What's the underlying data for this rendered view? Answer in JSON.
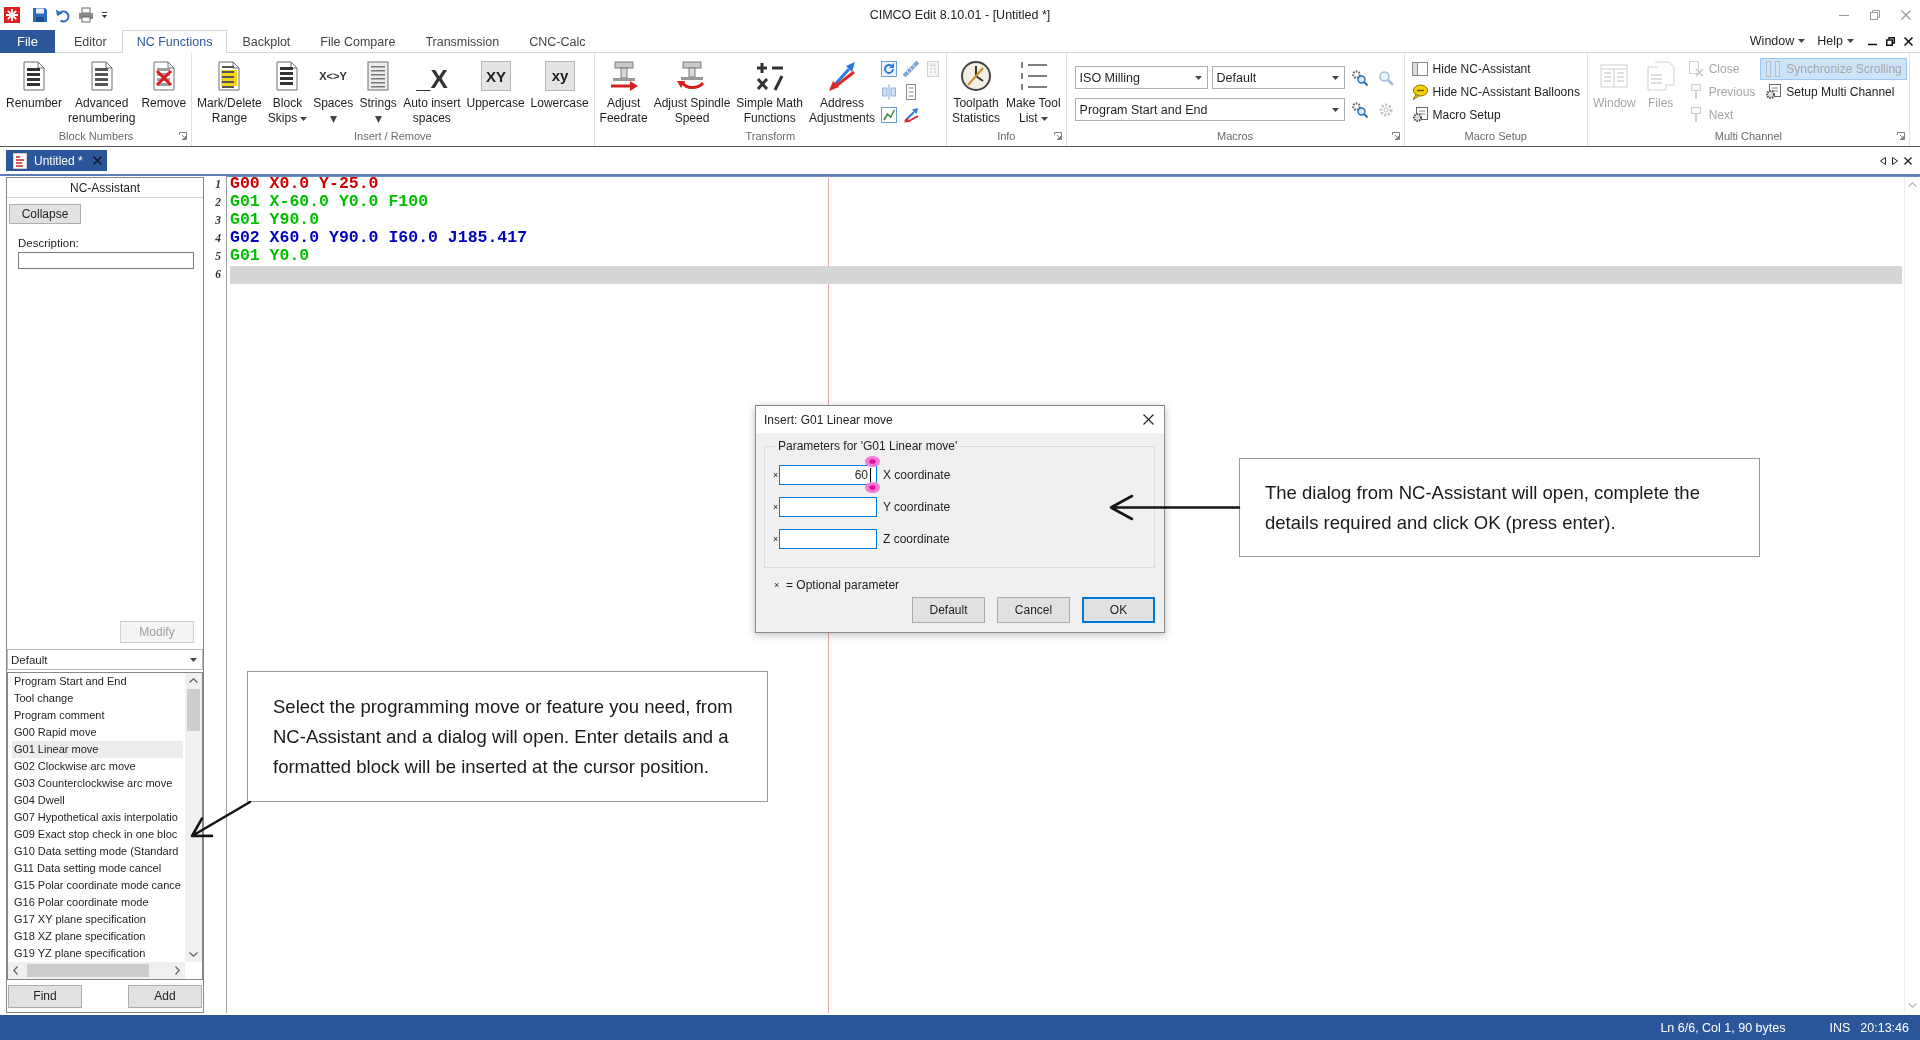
{
  "window": {
    "title": "CIMCO Edit 8.10.01 - [Untitled *]"
  },
  "file_button": {
    "label": "File"
  },
  "tabs": [
    {
      "label": "Editor",
      "selected": false
    },
    {
      "label": "NC Functions",
      "selected": true
    },
    {
      "label": "Backplot",
      "selected": false
    },
    {
      "label": "File Compare",
      "selected": false
    },
    {
      "label": "Transmission",
      "selected": false
    },
    {
      "label": "CNC-Calc",
      "selected": false
    }
  ],
  "menus": [
    {
      "label": "Window"
    },
    {
      "label": "Help"
    }
  ],
  "ribbon": {
    "groups": [
      {
        "label": "Block Numbers",
        "launcher": true,
        "columns": [
          [
            {
              "kind": "large",
              "label": "Renumber"
            }
          ],
          [
            {
              "kind": "large",
              "label": "Advanced\nrenumbering"
            }
          ],
          [
            {
              "kind": "large",
              "label": "Remove"
            }
          ]
        ]
      },
      {
        "label": "Insert / Remove",
        "launcher": false,
        "columns": [
          [
            {
              "kind": "large",
              "label": "Mark/Delete\nRange",
              "dropdown": false
            }
          ],
          [
            {
              "kind": "large",
              "label": "Block\nSkips",
              "dropdown": true
            }
          ],
          [
            {
              "kind": "large",
              "label": "Spaces",
              "glyph": "X<>Y",
              "dropdown": true
            }
          ],
          [
            {
              "kind": "large",
              "label": "Strings",
              "dropdown": true
            }
          ],
          [
            {
              "kind": "large",
              "label": "Auto insert\nspaces",
              "glyph": "_X",
              "dropdown": false
            }
          ],
          [
            {
              "kind": "large",
              "label": "Uppercase",
              "glyph": "XY",
              "dropdown": false
            }
          ],
          [
            {
              "kind": "large",
              "label": "Lowercase",
              "glyph": "xy",
              "dropdown": false
            }
          ]
        ]
      },
      {
        "label": "Transform",
        "launcher": false,
        "columns": [
          [
            {
              "kind": "large",
              "label": "Adjust\nFeedrate"
            }
          ],
          [
            {
              "kind": "large",
              "label": "Adjust Spindle\nSpeed"
            }
          ],
          [
            {
              "kind": "large",
              "label": "Simple Math\nFunctions"
            }
          ],
          [
            {
              "kind": "large",
              "label": "Address\nAdjustments"
            }
          ],
          [
            {
              "kind": "tool",
              "disabled": false
            },
            {
              "kind": "tool",
              "disabled": false
            },
            {
              "kind": "tool",
              "disabled": false
            }
          ],
          [
            {
              "kind": "tool",
              "disabled": false
            },
            {
              "kind": "tool",
              "disabled": false
            },
            {
              "kind": "tool",
              "disabled": false
            }
          ],
          [
            {
              "kind": "tool",
              "disabled": true
            }
          ]
        ]
      },
      {
        "label": "Info",
        "launcher": true,
        "columns": [
          [
            {
              "kind": "large",
              "label": "Toolpath\nStatistics",
              "dropdown": false
            }
          ],
          [
            {
              "kind": "large",
              "label": "Make Tool\nList",
              "dropdown": true
            }
          ]
        ]
      },
      {
        "label": "Macros",
        "launcher": true,
        "rows": [
          [
            {
              "kind": "combo",
              "value": "ISO Milling"
            },
            {
              "kind": "combo",
              "value": "Default"
            },
            {
              "kind": "tool",
              "disabled": false
            },
            {
              "kind": "tool",
              "disabled": true
            }
          ],
          [
            {
              "kind": "combo",
              "value": "Program Start and End"
            },
            {
              "kind": "tool",
              "disabled": false
            },
            {
              "kind": "tool",
              "disabled": true
            }
          ]
        ]
      },
      {
        "label": "Macro Setup",
        "launcher": false,
        "columns": [
          [
            {
              "kind": "small",
              "label": "Hide NC-Assistant"
            },
            {
              "kind": "small",
              "label": "Hide NC-Assistant Balloons"
            },
            {
              "kind": "small",
              "label": "Macro Setup"
            }
          ]
        ]
      },
      {
        "label": "Multi Channel",
        "launcher": true,
        "columns": [
          [
            {
              "kind": "large",
              "label": "Window",
              "disabled": true
            }
          ],
          [
            {
              "kind": "large",
              "label": "Files",
              "disabled": true
            }
          ],
          [
            {
              "kind": "small",
              "label": "Close",
              "disabled": true
            },
            {
              "kind": "small",
              "label": "Previous",
              "disabled": true
            },
            {
              "kind": "small",
              "label": "Next",
              "disabled": true
            }
          ],
          [
            {
              "kind": "small",
              "label": "Synchronize Scrolling",
              "disabled": true,
              "checked": true
            },
            {
              "kind": "small",
              "label": "Setup Multi Channel",
              "disabled": false,
              "checked": false
            }
          ]
        ]
      }
    ]
  },
  "document_tabs": [
    {
      "title": "Untitled *",
      "selected": true
    }
  ],
  "nc_assistant": {
    "title": "NC-Assistant",
    "collapse_button": {
      "label": "Collapse"
    },
    "description": {
      "label": "Description:"
    },
    "modify_button": {
      "label": "Modify",
      "disabled": true
    },
    "category": {
      "value": "Default"
    },
    "items": [
      {
        "label": "Program Start and End",
        "selected": false
      },
      {
        "label": "Tool change",
        "selected": false
      },
      {
        "label": "Program comment",
        "selected": false
      },
      {
        "label": "G00 Rapid move",
        "selected": false
      },
      {
        "label": "G01 Linear move",
        "selected": true
      },
      {
        "label": "G02 Clockwise arc move",
        "selected": false
      },
      {
        "label": "G03 Counterclockwise arc move",
        "selected": false
      },
      {
        "label": "G04 Dwell",
        "selected": false
      },
      {
        "label": "G07 Hypothetical axis interpolatio",
        "selected": false
      },
      {
        "label": "G09 Exact stop check in one bloc",
        "selected": false
      },
      {
        "label": "G10 Data setting mode (Standard",
        "selected": false
      },
      {
        "label": "G11 Data setting mode cancel",
        "selected": false
      },
      {
        "label": "G15 Polar coordinate mode cance",
        "selected": false
      },
      {
        "label": "G16 Polar coordinate mode",
        "selected": false
      },
      {
        "label": "G17 XY plane specification",
        "selected": false
      },
      {
        "label": "G18 XZ plane specification",
        "selected": false
      },
      {
        "label": "G19 YZ plane specification",
        "selected": false
      }
    ],
    "find_button": {
      "label": "Find"
    },
    "add_button": {
      "label": "Add"
    }
  },
  "editor": {
    "lines": [
      {
        "number": "1",
        "text": "G00 X0.0 Y-25.0",
        "color": "#cc0000",
        "current": false
      },
      {
        "number": "2",
        "text": "G01 X-60.0 Y0.0 F100",
        "color": "#00c000",
        "current": false
      },
      {
        "number": "3",
        "text": "G01 Y90.0",
        "color": "#00c000",
        "current": false
      },
      {
        "number": "4",
        "text": "G02 X60.0 Y90.0 I60.0 J185.417",
        "color": "#0000c0",
        "current": false
      },
      {
        "number": "5",
        "text": "G01 Y0.0",
        "color": "#00c000",
        "current": false
      },
      {
        "number": "6",
        "current": true
      }
    ]
  },
  "dialog": {
    "title": "Insert: G01 Linear move",
    "group_title": "Parameters for 'G01 Linear move'",
    "fields": [
      {
        "marker": "×",
        "value": "60",
        "label": "X coordinate",
        "focused": true
      },
      {
        "marker": "×",
        "label": "Y coordinate",
        "focused": false
      },
      {
        "marker": "×",
        "label": "Z coordinate",
        "focused": false
      }
    ],
    "legend": {
      "marker": "×",
      "text": "= Optional parameter"
    },
    "buttons": [
      {
        "label": "Default",
        "default": false
      },
      {
        "label": "Cancel",
        "default": false
      },
      {
        "label": "OK",
        "default": true
      }
    ]
  },
  "callouts": [
    {
      "text": "The dialog from NC-Assistant will open, complete the details required and click OK (press enter)."
    },
    {
      "text": "Select the programming move or feature you need, from NC-Assistant and a dialog will open. Enter details and a formatted block will be inserted at the cursor position."
    }
  ],
  "status_bar": {
    "position": "Ln 6/6, Col 1, 90 bytes",
    "mode": "INS",
    "time": "20:13:46"
  }
}
